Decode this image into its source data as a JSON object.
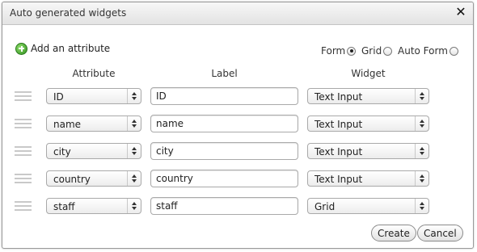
{
  "dialog": {
    "title": "Auto generated widgets"
  },
  "actions": {
    "add_attribute": "Add an attribute",
    "create": "Create",
    "cancel": "Cancel"
  },
  "modes": [
    {
      "label": "Form",
      "selected": true
    },
    {
      "label": "Grid",
      "selected": false
    },
    {
      "label": "Auto Form",
      "selected": false
    }
  ],
  "columns": {
    "attribute": "Attribute",
    "label": "Label",
    "widget": "Widget"
  },
  "rows": [
    {
      "attribute": "ID",
      "label": "ID",
      "widget": "Text Input"
    },
    {
      "attribute": "name",
      "label": "name",
      "widget": "Text Input"
    },
    {
      "attribute": "city",
      "label": "city",
      "widget": "Text Input"
    },
    {
      "attribute": "country",
      "label": "country",
      "widget": "Text Input"
    },
    {
      "attribute": "staff",
      "label": "staff",
      "widget": "Grid"
    }
  ],
  "icons": {
    "close": "close-icon",
    "add": "add-icon",
    "drag": "drag-handle-icon"
  }
}
